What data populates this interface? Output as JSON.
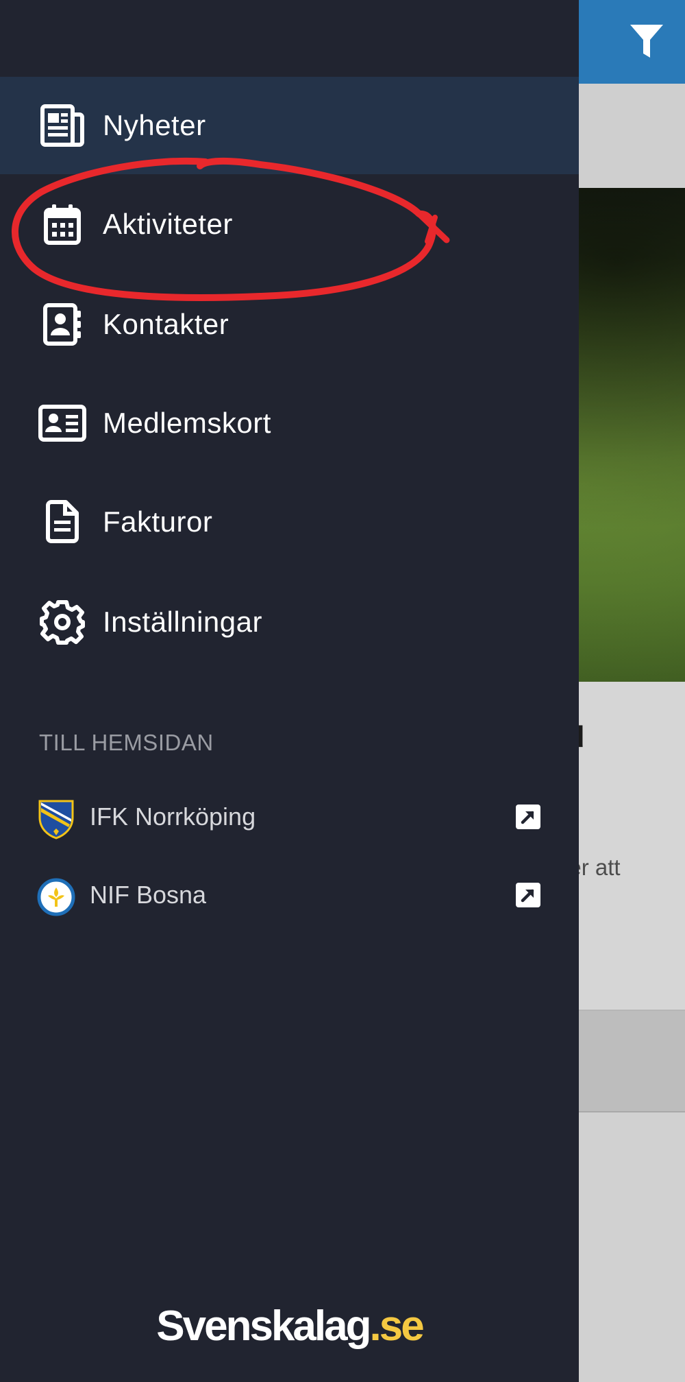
{
  "colors": {
    "drawer_bg": "#212430",
    "active_item_bg": "#243349",
    "topbar_blue": "#2a7ab8",
    "brand_accent": "#f4c842",
    "annotation_red": "#e8282c"
  },
  "background": {
    "card_title_fragment": "fd",
    "card_text_fragment": "fter att",
    "filter_icon": "filter-icon"
  },
  "nav": {
    "items": [
      {
        "label": "Nyheter",
        "icon": "newspaper-icon",
        "active": true
      },
      {
        "label": "Aktiviteter",
        "icon": "calendar-icon",
        "active": false
      },
      {
        "label": "Kontakter",
        "icon": "contact-book-icon",
        "active": false
      },
      {
        "label": "Medlemskort",
        "icon": "id-card-icon",
        "active": false
      },
      {
        "label": "Fakturor",
        "icon": "invoice-document-icon",
        "active": false
      },
      {
        "label": "Inställningar",
        "icon": "gear-icon",
        "active": false
      }
    ]
  },
  "hemsidan": {
    "title": "TILL HEMSIDAN",
    "clubs": [
      {
        "name": "IFK Norrköping",
        "logo": "ifk-norrkoping-crest",
        "link_icon": "external-link-icon"
      },
      {
        "name": "NIF Bosna",
        "logo": "nif-bosna-crest",
        "link_icon": "external-link-icon"
      }
    ]
  },
  "brand": {
    "main": "Svenskalag",
    "tld": ".se"
  },
  "annotation": {
    "shape": "hand-drawn red ellipse",
    "target": "Aktiviteter"
  }
}
